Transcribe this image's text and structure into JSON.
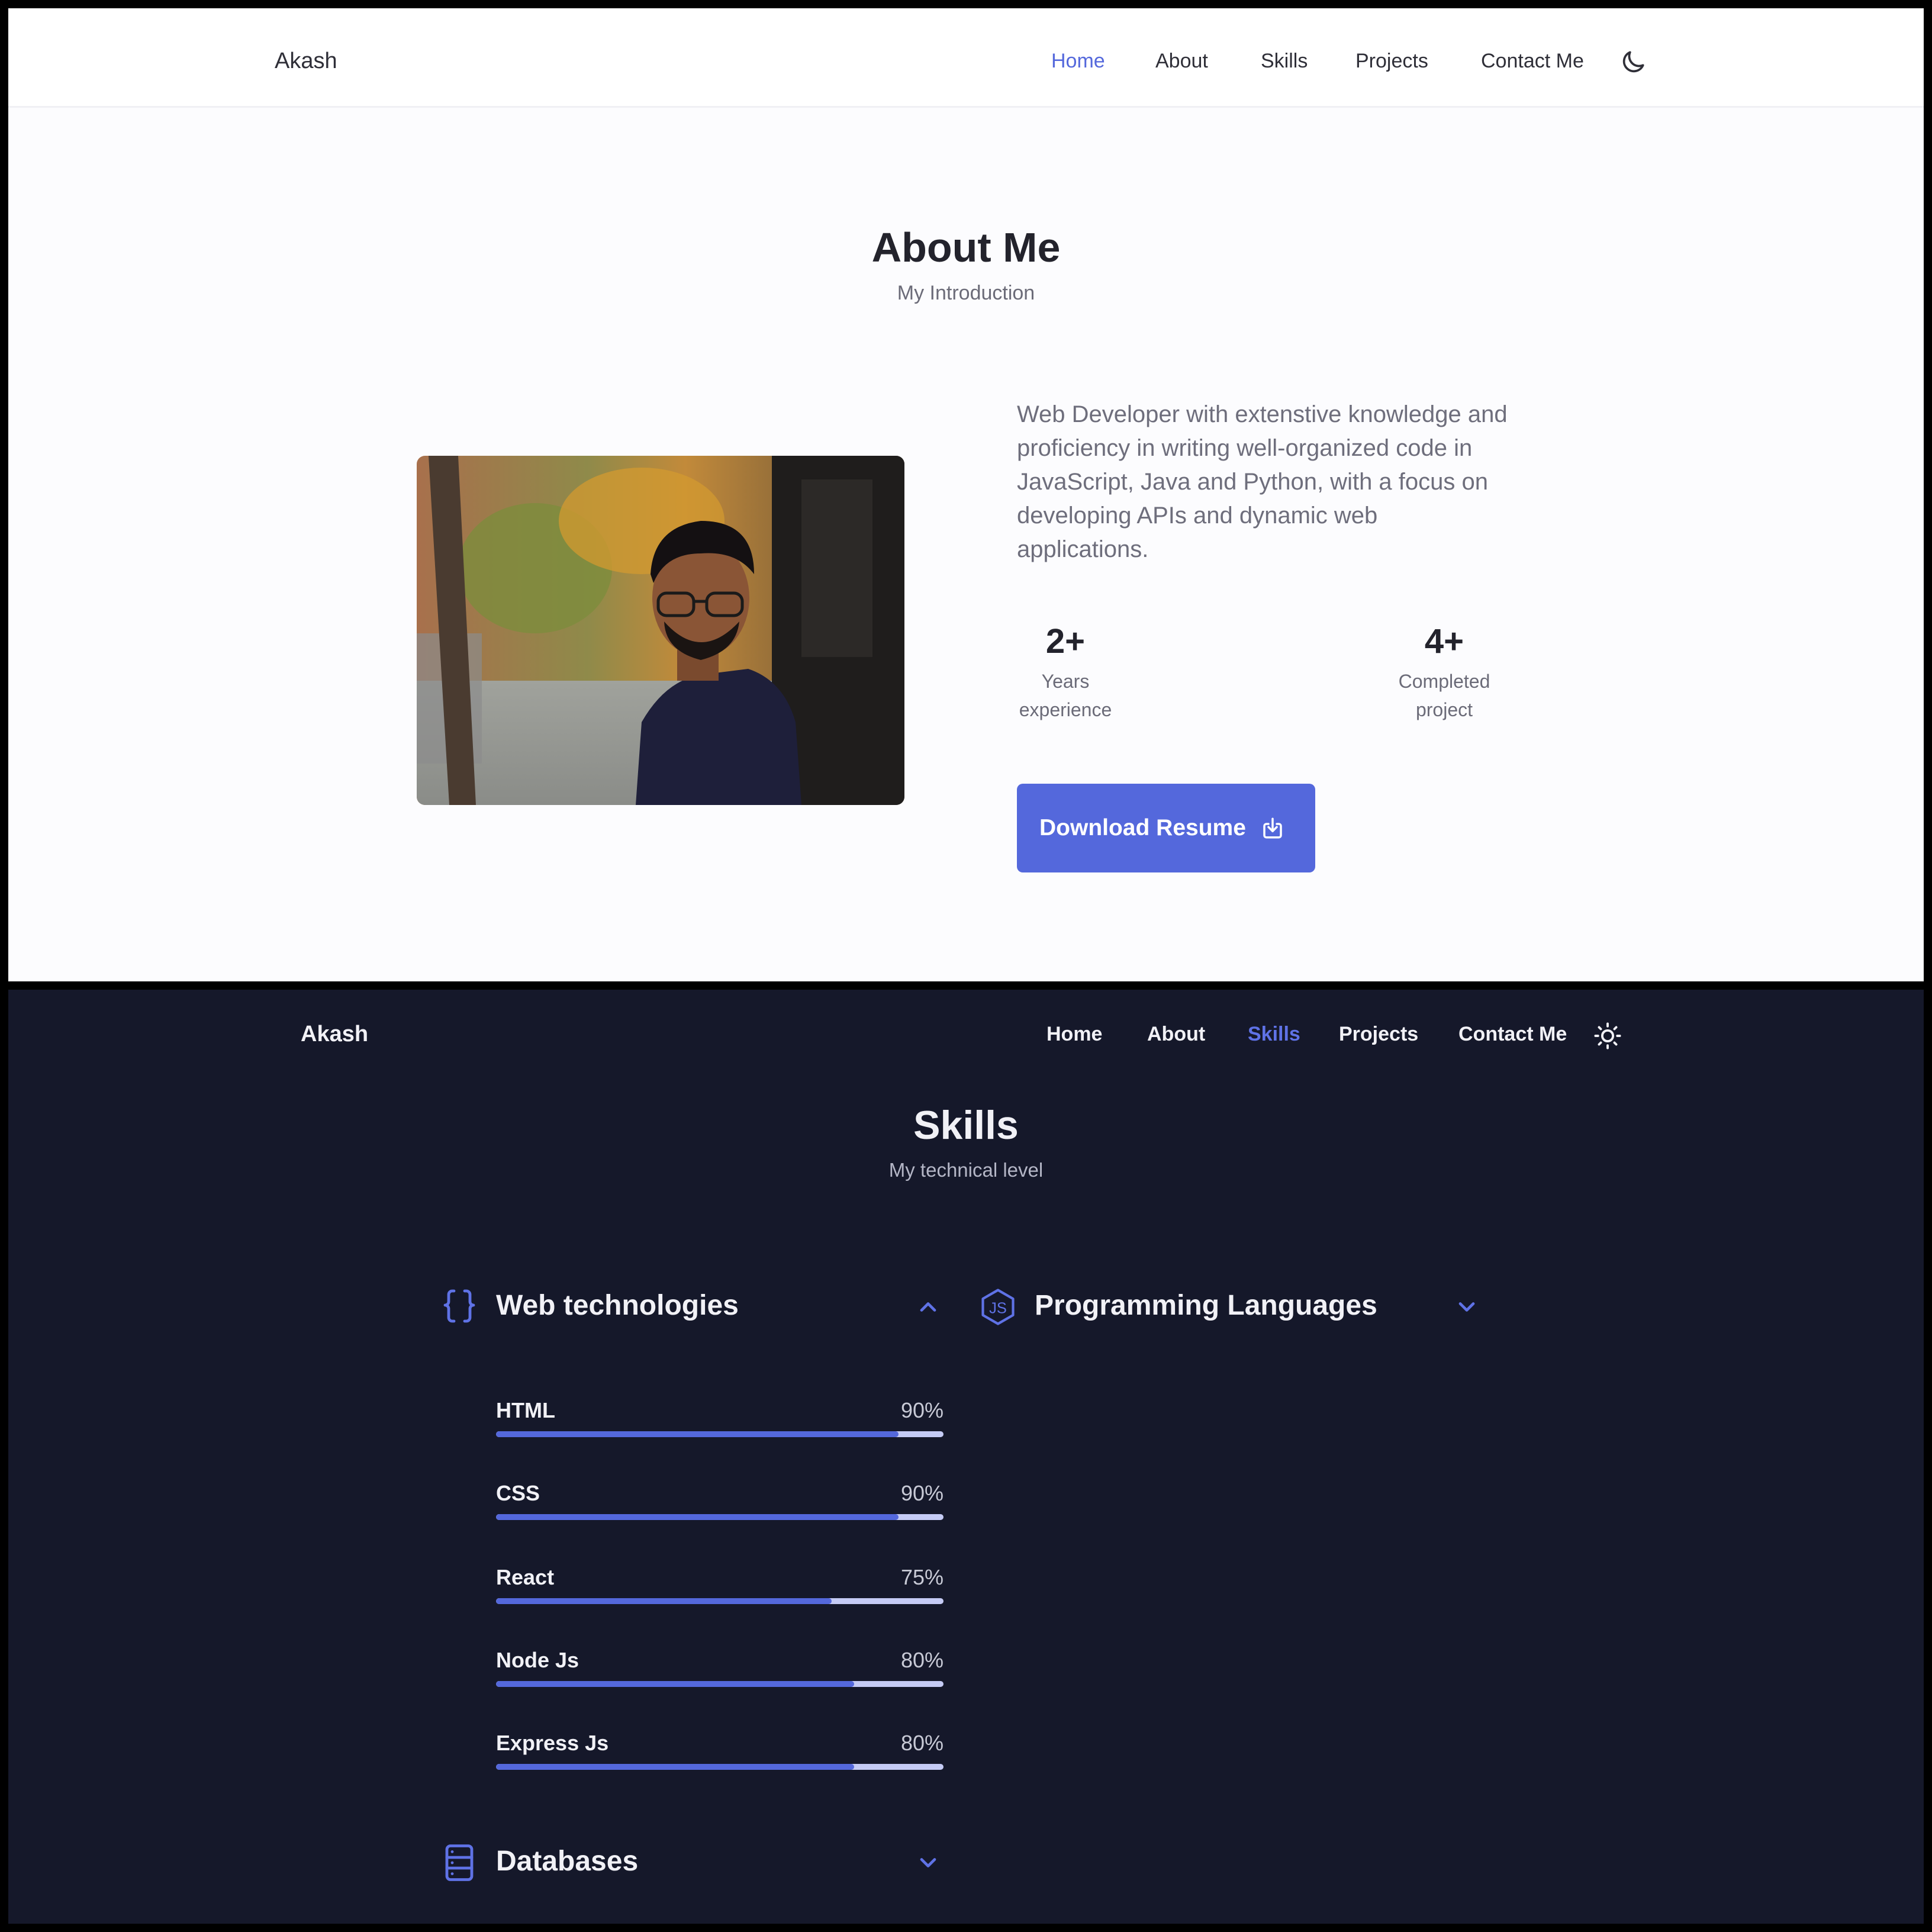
{
  "light": {
    "brand": "Akash",
    "nav": [
      {
        "label": "Home",
        "active": true
      },
      {
        "label": "About"
      },
      {
        "label": "Skills"
      },
      {
        "label": "Projects"
      },
      {
        "label": "Contact Me"
      }
    ],
    "theme_icon": "moon-icon",
    "section_title": "About Me",
    "section_subtitle": "My Introduction",
    "description": "Web Developer with extenstive knowledge and proficiency in writing well-organized code in JavaScript, Java and Python, with a focus on developing APIs and dynamic web applications.",
    "stats": [
      {
        "number": "2+",
        "label_line1": "Years",
        "label_line2": "experience"
      },
      {
        "number": "4+",
        "label_line1": "Completed",
        "label_line2": "project"
      }
    ],
    "download_button": "Download Resume",
    "download_icon": "download-icon",
    "accent": "#5468dc"
  },
  "dark": {
    "brand": "Akash",
    "nav": [
      {
        "label": "Home"
      },
      {
        "label": "About"
      },
      {
        "label": "Skills",
        "active": true
      },
      {
        "label": "Projects"
      },
      {
        "label": "Contact Me"
      }
    ],
    "theme_icon": "sun-icon",
    "section_title": "Skills",
    "section_subtitle": "My technical level",
    "categories": [
      {
        "name": "Web technologies",
        "icon": "braces-icon",
        "expanded": true
      },
      {
        "name": "Programming Languages",
        "icon": "javascript-icon",
        "expanded": false
      },
      {
        "name": "Databases",
        "icon": "database-icon",
        "expanded": false
      }
    ],
    "skills": [
      {
        "name": "HTML",
        "percent_label": "90%",
        "level": 0.9
      },
      {
        "name": "CSS",
        "percent_label": "90%",
        "level": 0.9
      },
      {
        "name": "React",
        "percent_label": "75%",
        "level": 0.75
      },
      {
        "name": "Node Js",
        "percent_label": "80%",
        "level": 0.8
      },
      {
        "name": "Express Js",
        "percent_label": "80%",
        "level": 0.8
      }
    ],
    "background": "#15182a",
    "accent": "#5468dc"
  }
}
